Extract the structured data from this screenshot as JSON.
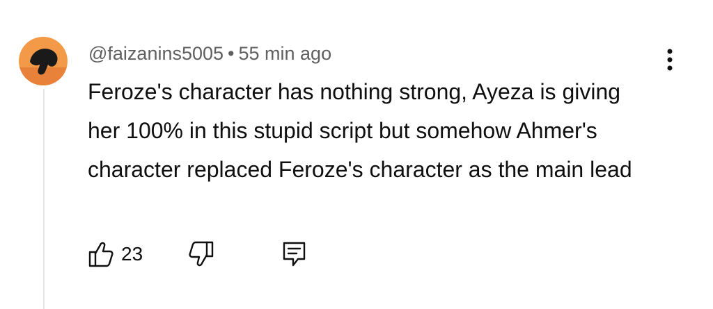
{
  "comment": {
    "author": "@faizanins5005",
    "separator": "•",
    "time_ago": "55 min ago",
    "text": "Feroze's character has nothing strong, Ayeza is giving her 100% in this stupid script but somehow Ahmer's character replaced Feroze's character as the main lead",
    "like_count": "23"
  },
  "icons": {
    "like": "thumbs-up-icon",
    "dislike": "thumbs-down-icon",
    "reply": "reply-comment-icon",
    "menu": "more-vertical-icon"
  },
  "colors": {
    "meta_text": "#606060",
    "body_text": "#0f0f0f",
    "thread_line": "#e5e5e5",
    "avatar_bg": "#f29a47"
  }
}
